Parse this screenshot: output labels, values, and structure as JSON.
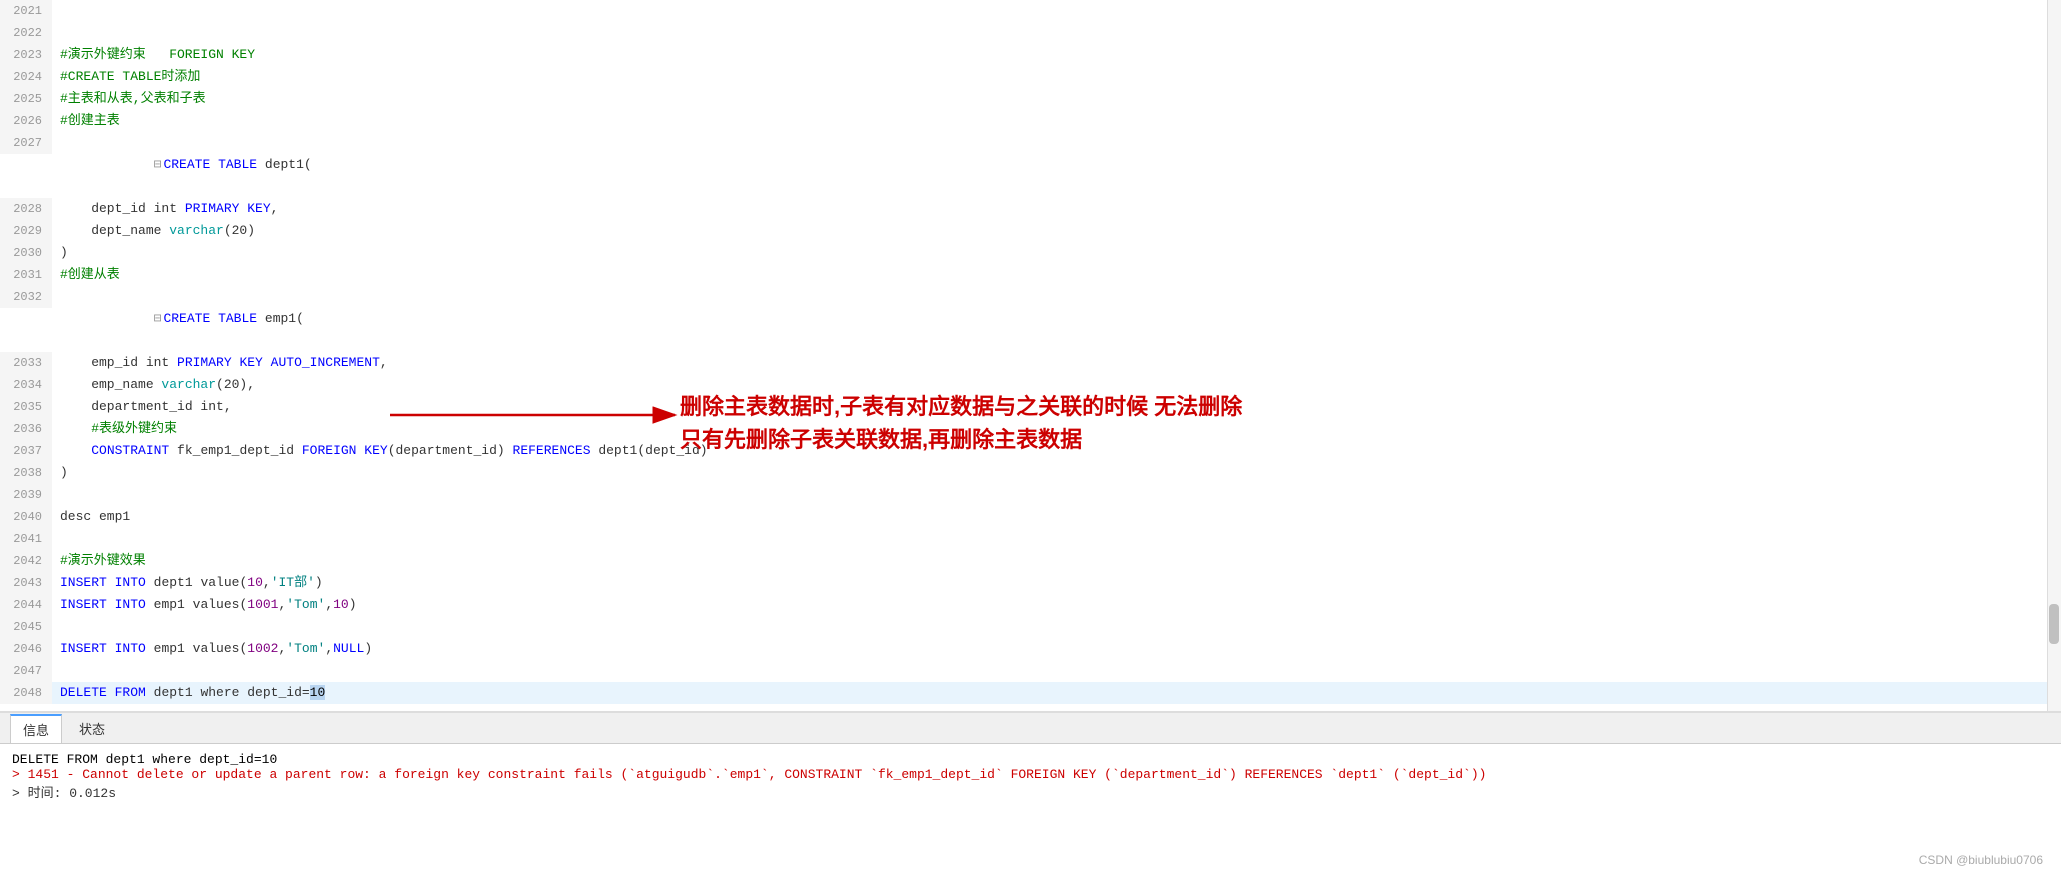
{
  "editor": {
    "lines": [
      {
        "num": 2021,
        "content": "",
        "type": "normal"
      },
      {
        "num": 2022,
        "content": "",
        "type": "normal"
      },
      {
        "num": 2023,
        "content": "#演示外键约束   FOREIGN KEY",
        "type": "comment"
      },
      {
        "num": 2024,
        "content": "#CREATE TABLE时添加",
        "type": "comment"
      },
      {
        "num": 2025,
        "content": "#主表和从表,父表和子表",
        "type": "comment"
      },
      {
        "num": 2026,
        "content": "#创建主表",
        "type": "comment"
      },
      {
        "num": 2027,
        "content": "CREATE TABLE dept1(",
        "type": "code_create",
        "collapse": true
      },
      {
        "num": 2028,
        "content": "    dept_id int PRIMARY KEY,",
        "type": "code"
      },
      {
        "num": 2029,
        "content": "    dept_name varchar(20)",
        "type": "code"
      },
      {
        "num": 2030,
        "content": ")",
        "type": "normal"
      },
      {
        "num": 2031,
        "content": "#创建从表",
        "type": "comment"
      },
      {
        "num": 2032,
        "content": "CREATE TABLE emp1(",
        "type": "code_create",
        "collapse": true
      },
      {
        "num": 2033,
        "content": "    emp_id int PRIMARY KEY AUTO_INCREMENT,",
        "type": "code"
      },
      {
        "num": 2034,
        "content": "    emp_name varchar(20),",
        "type": "code"
      },
      {
        "num": 2035,
        "content": "    department_id int,",
        "type": "code"
      },
      {
        "num": 2036,
        "content": "    #表级外键约束",
        "type": "comment_inline"
      },
      {
        "num": 2037,
        "content": "    CONSTRAINT fk_emp1_dept_id FOREIGN KEY(department_id) REFERENCES dept1(dept_id)",
        "type": "code_constraint"
      },
      {
        "num": 2038,
        "content": ")",
        "type": "normal"
      },
      {
        "num": 2039,
        "content": "",
        "type": "normal"
      },
      {
        "num": 2040,
        "content": "desc emp1",
        "type": "code"
      },
      {
        "num": 2041,
        "content": "",
        "type": "normal"
      },
      {
        "num": 2042,
        "content": "#演示外键效果",
        "type": "comment"
      },
      {
        "num": 2043,
        "content": "INSERT INTO dept1 value(10,'IT部')",
        "type": "code_insert"
      },
      {
        "num": 2044,
        "content": "INSERT INTO emp1 values(1001,'Tom',10)",
        "type": "code_insert"
      },
      {
        "num": 2045,
        "content": "",
        "type": "normal"
      },
      {
        "num": 2046,
        "content": "INSERT INTO emp1 values(1002,'Tom',NULL)",
        "type": "code_insert"
      },
      {
        "num": 2047,
        "content": "",
        "type": "normal"
      },
      {
        "num": 2048,
        "content": "DELETE FROM dept1 where dept_id=10",
        "type": "code_delete",
        "highlighted": true
      }
    ]
  },
  "annotation": {
    "text_line1": "删除主表数据时,子表有对应数据与之关联的时候 无法删除",
    "text_line2": "只有先删除子表关联数据,再删除主表数据"
  },
  "bottom_panel": {
    "tabs": [
      "信息",
      "状态"
    ],
    "active_tab": "信息",
    "content_lines": [
      {
        "text": "DELETE FROM dept1 where dept_id=10",
        "type": "normal"
      },
      {
        "text": "> 1451 - Cannot delete or update a parent row: a foreign key constraint fails (`atguigudb`.`emp1`, CONSTRAINT `fk_emp1_dept_id` FOREIGN KEY (`department_id`) REFERENCES `dept1` (`dept_id`))",
        "type": "error"
      },
      {
        "text": "> 时间: 0.012s",
        "type": "normal"
      }
    ]
  },
  "watermark": {
    "text": "CSDN @biublubiu0706"
  }
}
